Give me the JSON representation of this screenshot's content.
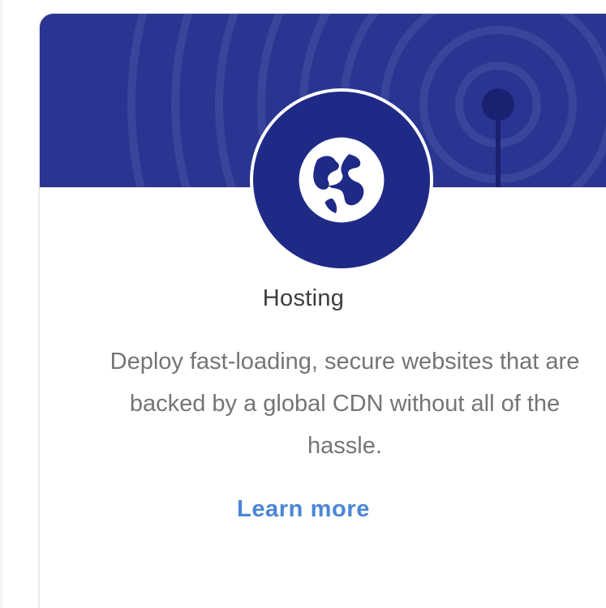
{
  "card": {
    "title": "Hosting",
    "description": "Deploy fast-loading, secure websites that are backed by a global CDN without all of the hassle.",
    "cta_label": "Learn more",
    "icon": "globe-icon",
    "banner_decoration": "broadcast-signal-icon"
  },
  "colors": {
    "banner": "#2a3592",
    "emblem": "#1f2a86",
    "title": "#3c3c3c",
    "description": "#757575",
    "link": "#4a86d6"
  }
}
